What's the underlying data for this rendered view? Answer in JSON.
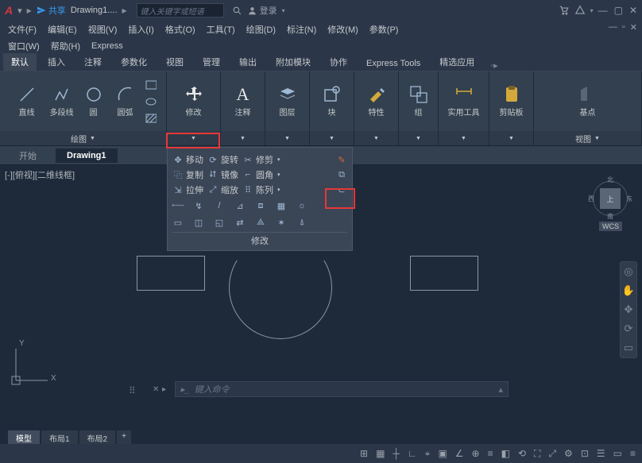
{
  "title": {
    "share": "共享",
    "doc": "Drawing1....",
    "search_ph": "键入关键字或短语",
    "login": "登录"
  },
  "menus": [
    "文件(F)",
    "编辑(E)",
    "视图(V)",
    "插入(I)",
    "格式(O)",
    "工具(T)",
    "绘图(D)",
    "标注(N)",
    "修改(M)",
    "参数(P)"
  ],
  "menus2": [
    "窗口(W)",
    "帮助(H)",
    "Express"
  ],
  "ribtabs": [
    "默认",
    "插入",
    "注释",
    "参数化",
    "视图",
    "管理",
    "输出",
    "附加模块",
    "协作",
    "Express Tools",
    "精选应用"
  ],
  "panels": {
    "draw": {
      "label": "绘图",
      "tools": [
        "直线",
        "多段线",
        "圆",
        "圆弧"
      ]
    },
    "modify": {
      "label": "修改"
    },
    "annot": {
      "label": "注释"
    },
    "layer": {
      "label": "图层"
    },
    "block": {
      "label": "块"
    },
    "prop": {
      "label": "特性"
    },
    "group": {
      "label": "组"
    },
    "util": {
      "label": "实用工具"
    },
    "clip": {
      "label": "剪贴板"
    },
    "base": {
      "label": "基点"
    },
    "view": {
      "label": "视图"
    }
  },
  "doctabs": {
    "start": "开始",
    "active": "Drawing1"
  },
  "viewport": "[-][俯视][二维线框]",
  "flyout": {
    "r1": [
      "移动",
      "旋转",
      "修剪"
    ],
    "r2": [
      "复制",
      "镜像",
      "圆角"
    ],
    "r3": [
      "拉伸",
      "缩放",
      "陈列"
    ],
    "label": "修改"
  },
  "navcube": {
    "top": "上",
    "wcs": "WCS",
    "n": "北",
    "s": "南",
    "e": "东",
    "w": "西"
  },
  "cmd": {
    "ph": "键入命令"
  },
  "layouts": [
    "模型",
    "布局1",
    "布局2"
  ]
}
